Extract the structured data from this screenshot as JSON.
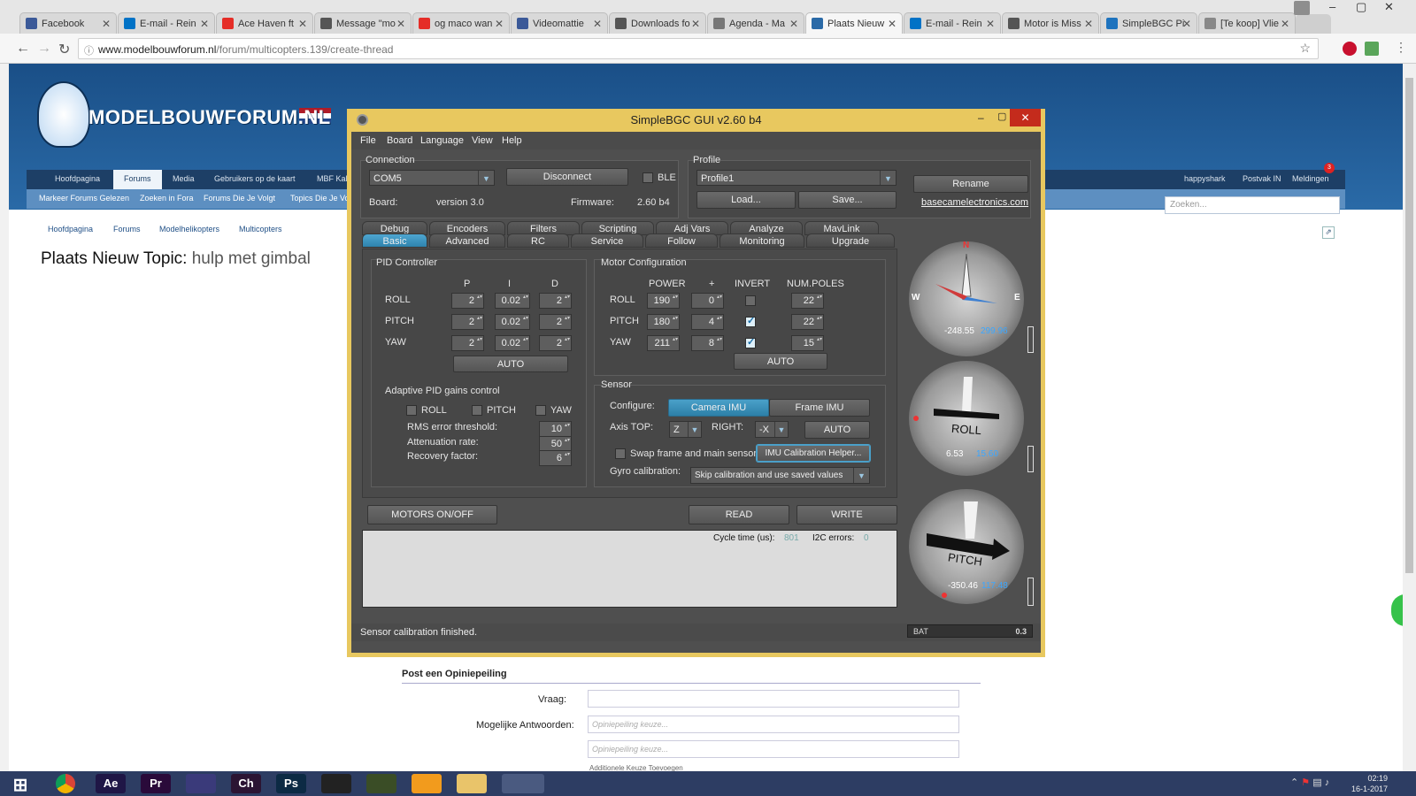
{
  "browser": {
    "tabs": [
      {
        "label": "Facebook",
        "icon": "facebook-icon",
        "color": "#3b5998"
      },
      {
        "label": "E-mail - Rein",
        "icon": "outlook-icon",
        "color": "#0072c6"
      },
      {
        "label": "Ace Haven ft",
        "icon": "youtube-icon",
        "color": "#e52d27"
      },
      {
        "label": "Message \"mo",
        "icon": "mail-icon",
        "color": "#555555"
      },
      {
        "label": "og maco wan",
        "icon": "youtube-icon",
        "color": "#e52d27"
      },
      {
        "label": "Videomattie",
        "icon": "facebook-icon",
        "color": "#3b5998"
      },
      {
        "label": "Downloads fo",
        "icon": "page-icon",
        "color": "#555555"
      },
      {
        "label": "Agenda - Ma",
        "icon": "people-icon",
        "color": "#777777"
      },
      {
        "label": "Plaats Nieuw",
        "icon": "forum-icon",
        "color": "#2a6aa7"
      },
      {
        "label": "E-mail - Rein",
        "icon": "outlook-icon",
        "color": "#0072c6"
      },
      {
        "label": "Motor is Miss",
        "icon": "page-icon",
        "color": "#555555"
      },
      {
        "label": "SimpleBGC Pi",
        "icon": "s-icon",
        "color": "#1e73be"
      },
      {
        "label": "[Te koop] Vlie",
        "icon": "gear-icon",
        "color": "#888888"
      }
    ],
    "active_tab": 8,
    "url_host": "www.modelbouwforum.nl",
    "url_path": "/forum/multicopters.139/create-thread"
  },
  "forum": {
    "logo_text": "MODELBOUWFORUM.NL",
    "nav1": [
      "Hoofdpagina",
      "Forums",
      "Media",
      "Gebruikers op de kaart",
      "MBF Kal"
    ],
    "nav1_right": [
      "happyshark",
      "Postvak IN",
      "Meldingen"
    ],
    "notification_count": "3",
    "nav2": [
      "Markeer Forums Gelezen",
      "Zoeken in Fora",
      "Forums Die Je Volgt",
      "Topics Die Je Vo"
    ],
    "search_placeholder": "Zoeken...",
    "breadcrumb": [
      "Hoofdpagina",
      "Forums",
      "Modelhelikopters",
      "Multicopters"
    ],
    "page_title_prefix": "Plaats Nieuw Topic:",
    "page_title_value": "hulp met gimbal",
    "poll_heading": "Post een Opiniepeiling",
    "poll_question_label": "Vraag:",
    "poll_answers_label": "Mogelijke Antwoorden:",
    "poll_answer_placeholder": "Opiniepeiling keuze...",
    "poll_add_more": "Additionele Keuze Toevoegen"
  },
  "app": {
    "title": "SimpleBGC GUI v2.60 b4",
    "menu": [
      "File",
      "Board",
      "Language",
      "View",
      "Help"
    ],
    "connection": {
      "group_label": "Connection",
      "port": "COM5",
      "disconnect_label": "Disconnect",
      "ble_label": "BLE",
      "board_label": "Board:",
      "board_value": "version 3.0",
      "firmware_label": "Firmware:",
      "firmware_value": "2.60 b4"
    },
    "profile": {
      "group_label": "Profile",
      "value": "Profile1",
      "load_label": "Load...",
      "save_label": "Save...",
      "rename_label": "Rename",
      "link": "basecamelectronics.com"
    },
    "tabs_row1": [
      "Debug",
      "Encoders",
      "Filters",
      "Scripting",
      "Adj Vars",
      "Analyze",
      "MavLink"
    ],
    "tabs_row2": [
      "Basic",
      "Advanced",
      "RC",
      "Service",
      "Follow",
      "Monitoring",
      "Upgrade"
    ],
    "active_tab": "Basic",
    "pid": {
      "group_label": "PID Controller",
      "headers": [
        "P",
        "I",
        "D"
      ],
      "rows": [
        {
          "axis": "ROLL",
          "p": "2",
          "i": "0.02",
          "d": "2"
        },
        {
          "axis": "PITCH",
          "p": "2",
          "i": "0.02",
          "d": "2"
        },
        {
          "axis": "YAW",
          "p": "2",
          "i": "0.02",
          "d": "2"
        }
      ],
      "auto_label": "AUTO",
      "adaptive_label": "Adaptive PID gains control",
      "adaptive_axes": [
        {
          "label": "ROLL",
          "checked": false
        },
        {
          "label": "PITCH",
          "checked": false
        },
        {
          "label": "YAW",
          "checked": false
        }
      ],
      "rms_label": "RMS error threshold:",
      "rms_value": "10",
      "atten_label": "Attenuation rate:",
      "atten_value": "50",
      "recovery_label": "Recovery factor:",
      "recovery_value": "6"
    },
    "motor": {
      "group_label": "Motor Configuration",
      "headers": [
        "POWER",
        "+",
        "INVERT",
        "NUM.POLES"
      ],
      "rows": [
        {
          "axis": "ROLL",
          "power": "190",
          "plus": "0",
          "invert": false,
          "poles": "22"
        },
        {
          "axis": "PITCH",
          "power": "180",
          "plus": "4",
          "invert": true,
          "poles": "22"
        },
        {
          "axis": "YAW",
          "power": "211",
          "plus": "8",
          "invert": true,
          "poles": "15"
        }
      ],
      "auto_label": "AUTO"
    },
    "sensor": {
      "group_label": "Sensor",
      "configure_label": "Configure:",
      "camera_imu": "Camera IMU",
      "frame_imu": "Frame IMU",
      "axis_top_label": "Axis TOP:",
      "axis_top_value": "Z",
      "right_label": "RIGHT:",
      "right_value": "-X",
      "auto_label": "AUTO",
      "swap_label": "Swap frame and main sensors",
      "swap_checked": false,
      "imu_helper_label": "IMU Calibration Helper...",
      "gyro_label": "Gyro calibration:",
      "gyro_value": "Skip calibration and use saved values"
    },
    "buttons": {
      "motors": "MOTORS ON/OFF",
      "read": "READ",
      "write": "WRITE"
    },
    "cycle_label": "Cycle time (us):",
    "cycle_value": "801",
    "i2c_label": "I2C errors:",
    "i2c_value": "0",
    "status": "Sensor calibration finished.",
    "bat_label": "BAT",
    "bat_value": "0.3",
    "gauges": {
      "yaw": {
        "cardinals": [
          "N",
          "W",
          "E"
        ],
        "value1": "-248.55",
        "value2": "299.96"
      },
      "roll": {
        "label": "ROLL",
        "value1": "6.53",
        "value2": "15.60"
      },
      "pitch": {
        "label": "PITCH",
        "value1": "-350.46",
        "value2": "117.48"
      }
    }
  },
  "taskbar": {
    "apps": [
      {
        "label": "",
        "icon": "windows-start-icon",
        "color": "#ffffff"
      },
      {
        "label": "",
        "icon": "chrome-icon",
        "color": "#4caf50"
      },
      {
        "label": "Ae",
        "icon": "after-effects-icon",
        "color": "#1f1646"
      },
      {
        "label": "Pr",
        "icon": "premiere-icon",
        "color": "#2a0a3a"
      },
      {
        "label": "",
        "icon": "clapper-icon",
        "color": "#3a3a7a"
      },
      {
        "label": "Ch",
        "icon": "character-animator-icon",
        "color": "#2b1433"
      },
      {
        "label": "Ps",
        "icon": "photoshop-icon",
        "color": "#0c2a44"
      },
      {
        "label": "",
        "icon": "film-icon",
        "color": "#222222"
      },
      {
        "label": "",
        "icon": "v-icon",
        "color": "#3a4d26"
      },
      {
        "label": "",
        "icon": "media-player-icon",
        "color": "#f29b1d"
      },
      {
        "label": "",
        "icon": "folder-icon",
        "color": "#e9c46a"
      },
      {
        "label": "",
        "icon": "simplebgc-icon",
        "color": "#6a6a6a"
      }
    ],
    "time": "02:19",
    "date": "16-1-2017"
  }
}
